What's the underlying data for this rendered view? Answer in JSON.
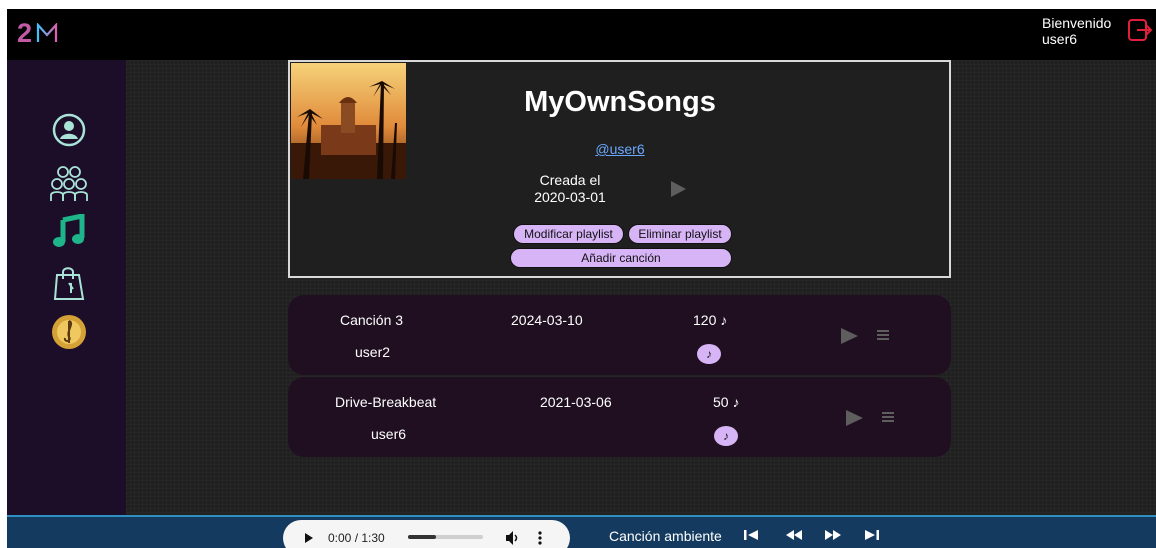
{
  "header": {
    "welcome_line1": "Bienvenido",
    "welcome_line2": "user6",
    "logout_icon": "logout-icon"
  },
  "sidebar": {
    "items": [
      {
        "name": "profile",
        "icon": "user-circle-icon"
      },
      {
        "name": "groups",
        "icon": "users-group-icon"
      },
      {
        "name": "music",
        "icon": "music-note-icon"
      },
      {
        "name": "shop",
        "icon": "shopping-bag-icon"
      },
      {
        "name": "premium",
        "icon": "treble-clef-medal-icon"
      }
    ]
  },
  "playlist": {
    "title": "MyOwnSongs",
    "owner": "@user6",
    "created_line1": "Creada el",
    "created_line2": "2020-03-01",
    "modify_label": "Modificar playlist",
    "delete_label": "Eliminar playlist",
    "add_label": "Añadir canción"
  },
  "songs": [
    {
      "title": "Canción 3",
      "date": "2024-03-10",
      "count": "120 ♪",
      "artist": "user2"
    },
    {
      "title": "Drive-Breakbeat",
      "date": "2021-03-06",
      "count": "50 ♪",
      "artist": "user6"
    }
  ],
  "player": {
    "time": "0:00 / 1:30",
    "progress": 0.0,
    "volume_fraction": 0.37,
    "track_label": "Canción ambiente"
  },
  "colors": {
    "accent_purple": "#d7b4f6",
    "sidebar_bg": "#1c0d28",
    "player_bg": "#143a60",
    "link_blue": "#6aa8ff",
    "music_green": "#1fb58b"
  }
}
